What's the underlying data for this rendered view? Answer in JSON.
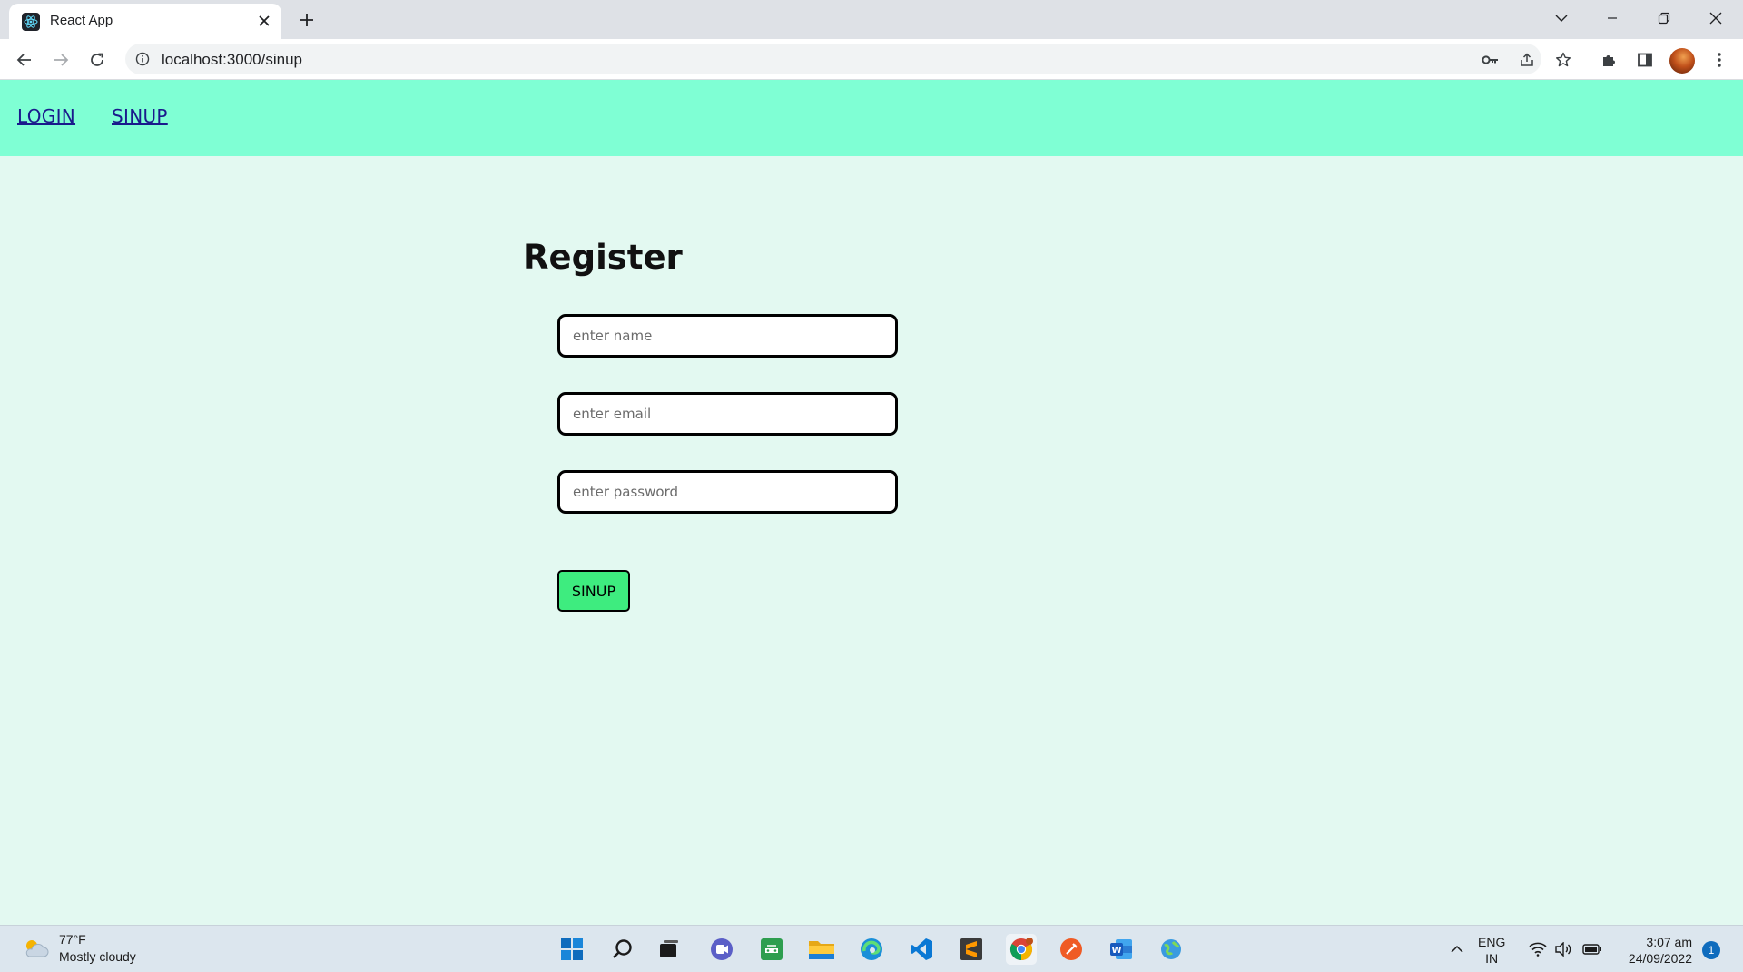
{
  "browser": {
    "tab_title": "React App",
    "url": "localhost:3000/sinup"
  },
  "nav": {
    "login": "LOGIN",
    "sinup": "SINUP"
  },
  "form": {
    "heading": "Register",
    "name_placeholder": "enter name",
    "email_placeholder": "enter email",
    "password_placeholder": "enter password",
    "submit_label": "SINUP"
  },
  "taskbar": {
    "temperature": "77°F",
    "weather": "Mostly cloudy",
    "lang_line1": "ENG",
    "lang_line2": "IN",
    "time": "3:07 am",
    "date": "24/09/2022",
    "notification_count": "1"
  },
  "colors": {
    "nav_bg": "#7fffd4",
    "page_bg": "#e3f9f1",
    "button_bg": "#3eec7f",
    "link": "#1a1a8c"
  }
}
